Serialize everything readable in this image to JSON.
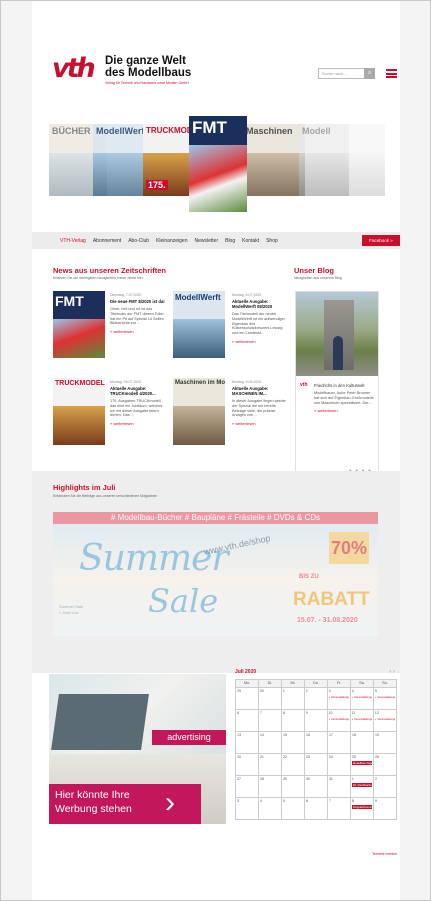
{
  "header": {
    "logo_text": "vth",
    "brand_line1": "Die ganze Welt",
    "brand_line2": "des Modellbaus",
    "brand_tagline": "Verlag für Technik und Handwerk neue Medien GmbH",
    "search_placeholder": "Suche nach...",
    "search_button_icon": "search-icon",
    "menu_icon": "hamburger-menu-icon"
  },
  "magazines": [
    "BÜCHER",
    "ModellWerft",
    "TRUCKMODELL",
    "FMT",
    "Maschinen",
    "Modell"
  ],
  "nav": {
    "items": [
      "VTH-Verlag",
      "Abonnement",
      "Abo-Club",
      "Kleinanzeigen",
      "Newsletter",
      "Blog",
      "Kontakt",
      "Shop"
    ],
    "facebook_button": "Facebook »"
  },
  "news": {
    "title": "News aus unseren Zeitschriften",
    "subtitle": "Erfahren Sie die wichtigsten Neuigkeiten immer direkt hier",
    "items": [
      {
        "cover": "FMT",
        "date": "Dienstag, 7.07.2020",
        "headline": "Die neue FMT 8/2020 ist da!",
        "body": "Ohne, hell und rot ist das Titelmotiv der FMT diesen Toller hat ihn Pit auf Spezial 14 Seiten Bildberichte zur ...",
        "more": "» weiterlesen"
      },
      {
        "cover": "ModellWerft",
        "date": "Montag, 6.07.2020",
        "headline": "Aktuelle Ausgabe: ModellWerft 08/2020",
        "body": "Das Titelmodell der neuen ModellWerft ist ein aufwendiger Eigenbau des Küstenschutzkreuzers Leipzig und ein Landesst...",
        "more": "» weiterlesen"
      },
      {
        "cover": "TRUCKMODELL",
        "date": "Montag, 06.07.2020",
        "headline": "Aktuelle Ausgabe: TRUCKmodell 4/2020...",
        "body": "175. Ausgaben TRUCKmodell - das sind ein Jubiläum, welches wir mit dieser Ausgabe feiern dürfen. Das ...",
        "more": "» weiterlesen"
      },
      {
        "cover": "Maschinen im Modellbau",
        "date": "Montag, 6.06.2020",
        "headline": "Aktuelle Ausgabe: MASCHINEN IM...",
        "body": "In dieser Ausgabe liegen wieder der Spezial die mit bereits Beiträge viele, die präzise Anlagen von ...",
        "more": "» weiterlesen"
      }
    ]
  },
  "blog": {
    "title": "Unser Blog",
    "subtitle": "Neuigkeiten aus unserem Blog",
    "card_logo": "vth",
    "headline": "Friedrichs in den Kulturwelt",
    "body": "Modellbauer, Autor Peter Brunner hat sich auf Eigenbau-Großmodelle von Maschinen spezialisiert. Der...",
    "more": "» weiterlesen",
    "pager": "● ● ● ●"
  },
  "highlights": {
    "title": "Highlights im Juli",
    "subtitle": "Entdecken Sie die Beiträge aus unseren verschiedenen Magazinen",
    "banner": {
      "top_line": "# Modellbau-Bücher   # Baupläne   # Frästeile   # DVDs & CDs",
      "summer": "Summer",
      "sale": "Sale",
      "url": "www.vth.de/shop",
      "percent": "70%",
      "bis_zu": "BIS ZU",
      "rabatt": "RABATT",
      "dates": "15.07. - 31.08.2020",
      "left_note": "Summer Sale\n» Jetzt Los"
    }
  },
  "ad": {
    "chip": "advertising",
    "line1": "Hier könnte Ihre",
    "line2": "Werbung stehen",
    "chevron": "›"
  },
  "calendar": {
    "title": "Juli 2020",
    "nav": "‹  ›",
    "weekdays": [
      "Mo.",
      "Di.",
      "Mi.",
      "Do.",
      "Fr.",
      "Sa.",
      "So."
    ],
    "weeks": [
      [
        {
          "d": "29"
        },
        {
          "d": "30"
        },
        {
          "d": "1"
        },
        {
          "d": "2"
        },
        {
          "d": "3",
          "e": "+ Veranstaltungen"
        },
        {
          "d": "4",
          "e": "+ Veranstaltungen"
        },
        {
          "d": "5",
          "e": "+ Veranstaltungen"
        }
      ],
      [
        {
          "d": "6"
        },
        {
          "d": "7"
        },
        {
          "d": "8"
        },
        {
          "d": "9"
        },
        {
          "d": "10",
          "e": "+ Veranstaltungen"
        },
        {
          "d": "11",
          "e": "+ Veranstaltungen"
        },
        {
          "d": "12",
          "e": "+ Veranstaltungen"
        }
      ],
      [
        {
          "d": "13"
        },
        {
          "d": "14"
        },
        {
          "d": "15"
        },
        {
          "d": "16"
        },
        {
          "d": "17"
        },
        {
          "d": "18"
        },
        {
          "d": "19"
        }
      ],
      [
        {
          "d": "20"
        },
        {
          "d": "21"
        },
        {
          "d": "22"
        },
        {
          "d": "23"
        },
        {
          "d": "24"
        },
        {
          "d": "25",
          "f": "Modellbau-Tage"
        },
        {
          "d": "26"
        }
      ],
      [
        {
          "d": "27"
        },
        {
          "d": "28"
        },
        {
          "d": "29"
        },
        {
          "d": "30"
        },
        {
          "d": "31"
        },
        {
          "d": "1",
          "f": "40. Fischbacher Bahn..."
        },
        {
          "d": "2"
        }
      ],
      [
        {
          "d": "3"
        },
        {
          "d": "4"
        },
        {
          "d": "5"
        },
        {
          "d": "6"
        },
        {
          "d": "7"
        },
        {
          "d": "8",
          "f": "Flugplatzfest aus..."
        },
        {
          "d": "9"
        }
      ]
    ],
    "footer_link": "Termine melden"
  },
  "colors": {
    "accent": "#c8102e",
    "ad_magenta": "#c2185b"
  }
}
